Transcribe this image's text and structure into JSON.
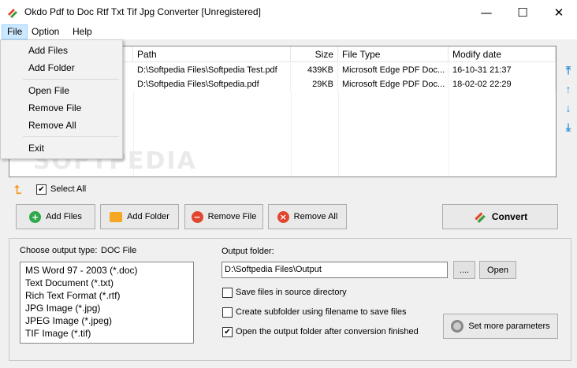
{
  "window": {
    "title": "Okdo Pdf to Doc Rtf Txt Tif Jpg Converter [Unregistered]",
    "minimize_glyph": "—",
    "maximize_glyph": "☐",
    "close_glyph": "✕"
  },
  "menubar": {
    "items": [
      "File",
      "Option",
      "Help"
    ]
  },
  "file_menu": {
    "items": [
      "Add Files",
      "Add Folder",
      "Open File",
      "Remove File",
      "Remove All",
      "Exit"
    ]
  },
  "file_list": {
    "columns": [
      "Path",
      "Size",
      "File Type",
      "Modify date"
    ],
    "rows": [
      {
        "path": "D:\\Softpedia Files\\Softpedia Test.pdf",
        "size": "439KB",
        "type": "Microsoft Edge PDF Doc...",
        "date": "16-10-31 21:37"
      },
      {
        "path": "D:\\Softpedia Files\\Softpedia.pdf",
        "size": "29KB",
        "type": "Microsoft Edge PDF Doc...",
        "date": "18-02-02 22:29"
      }
    ],
    "watermark": "SOFTPEDIA"
  },
  "select_all": {
    "label": "Select All",
    "checked_glyph": "✔"
  },
  "actions": {
    "add_files": "Add Files",
    "add_folder": "Add Folder",
    "remove_file": "Remove File",
    "remove_all": "Remove All",
    "convert": "Convert"
  },
  "output": {
    "type_label": "Choose output type:",
    "type_value": "DOC File",
    "types": [
      "MS Word 97 - 2003 (*.doc)",
      "Text Document (*.txt)",
      "Rich Text Format (*.rtf)",
      "JPG Image (*.jpg)",
      "JPEG Image (*.jpeg)",
      "TIF Image (*.tif)"
    ],
    "folder_label": "Output folder:",
    "folder_value": "D:\\Softpedia Files\\Output",
    "browse_label": "....",
    "open_label": "Open",
    "save_in_source": "Save files in source directory",
    "create_subfolder": "Create subfolder using filename to save files",
    "open_after": "Open the output folder after conversion finished",
    "open_after_glyph": "✔",
    "more_params": "Set more parameters"
  },
  "colors": {
    "accent": "#2a8fd6",
    "menu_highlight": "#cce8ff",
    "folder": "#f5a623"
  }
}
